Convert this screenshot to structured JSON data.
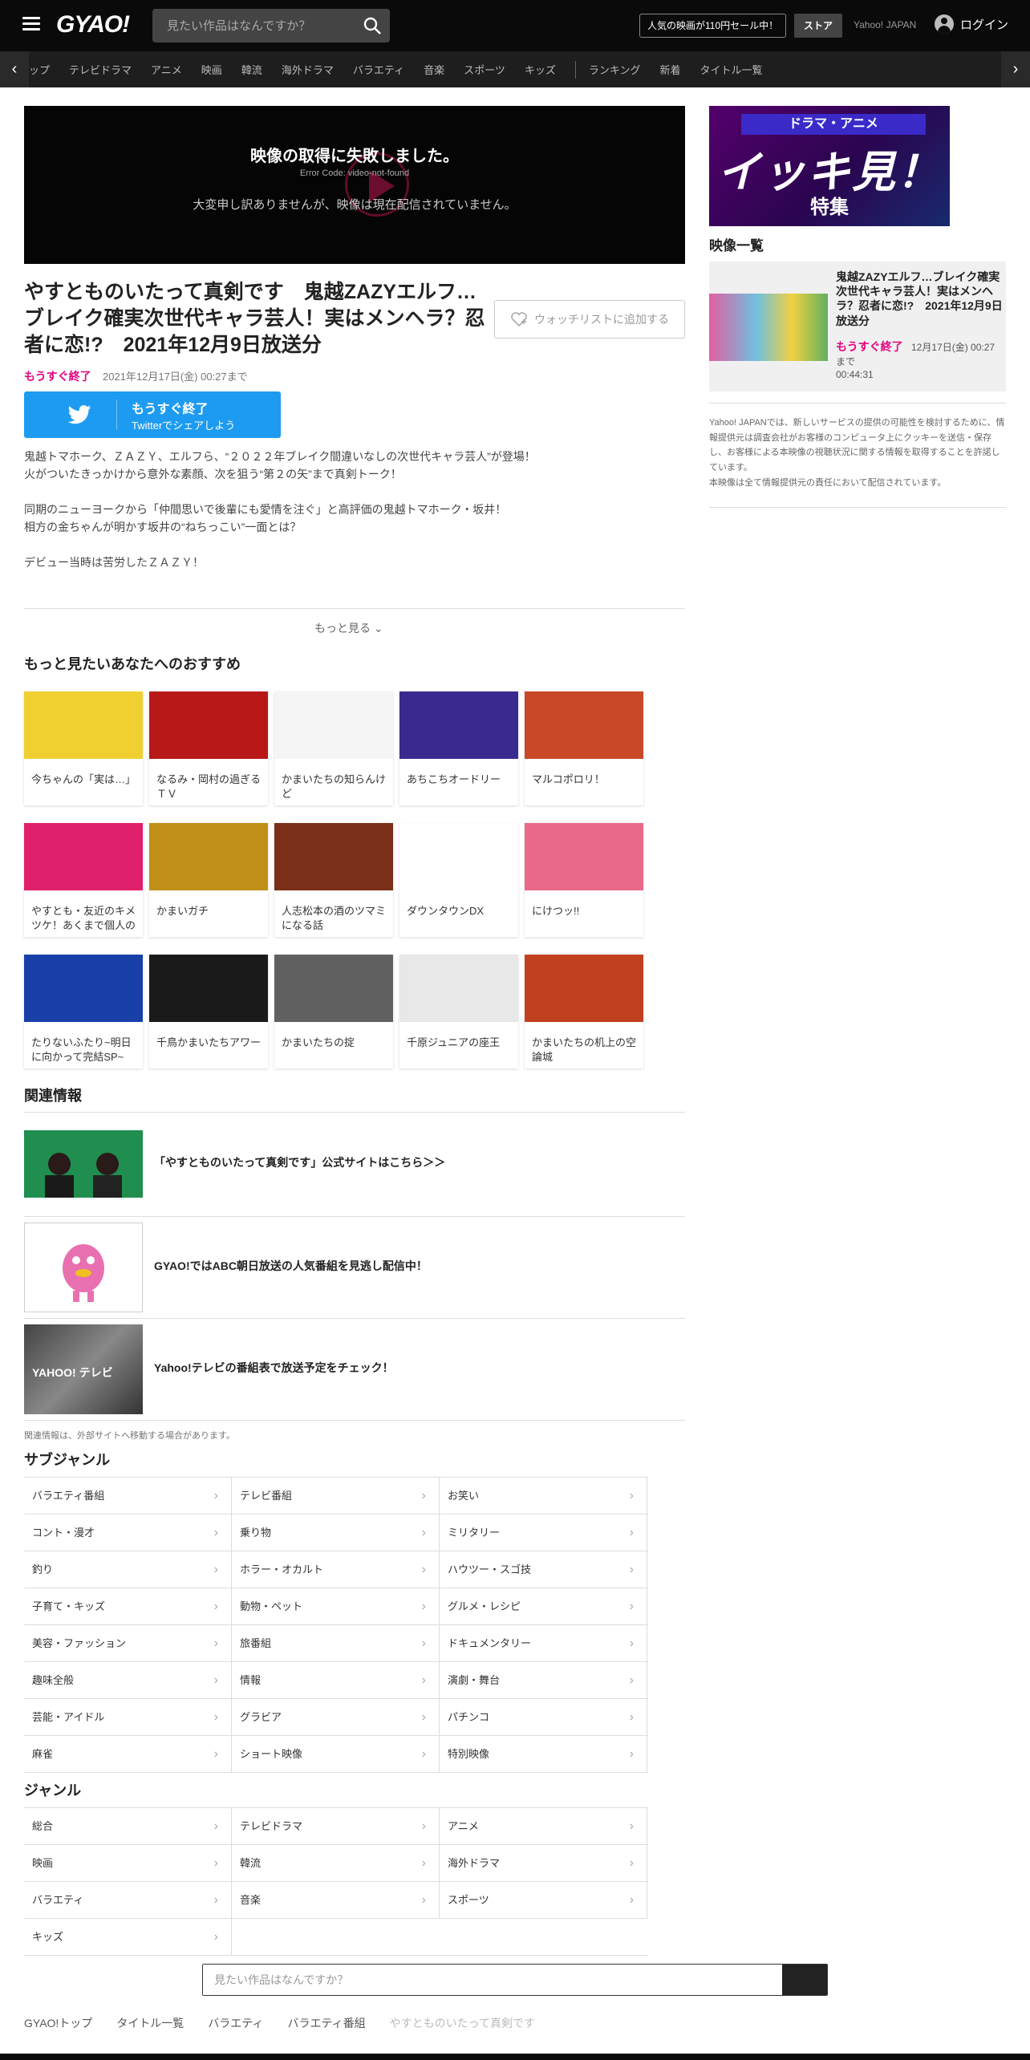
{
  "header": {
    "logo": "GYAO!",
    "search_placeholder": "見たい作品はなんですか？",
    "sale_badge": "人気の映画が110円セール中！",
    "store": "ストア",
    "yahoo_japan": "Yahoo! JAPAN",
    "login": "ログイン"
  },
  "nav": {
    "items": [
      "ップ",
      "テレビドラマ",
      "アニメ",
      "映画",
      "韓流",
      "海外ドラマ",
      "バラエティ",
      "音楽",
      "スポーツ",
      "キッズ"
    ],
    "items2": [
      "ランキング",
      "新着",
      "タイトル一覧"
    ]
  },
  "player": {
    "error_title": "映像の取得に失敗しました。",
    "error_code": "Error Code: video-not-found",
    "error_message": "大変申し訳ありませんが、映像は現在配信されていません。"
  },
  "episode": {
    "title": "やすとものいたって真剣です　鬼越ZAZYエルフ…ブレイク確実次世代キャラ芸人！実はメンヘラ？忍者に恋!?　2021年12月9日放送分",
    "watchlist": "ウォッチリストに追加する",
    "ending_label": "もうすぐ終了",
    "end_date": "2021年12月17日(金) 00:27まで",
    "twitter_main": "もうすぐ終了",
    "twitter_sub": "Twitterでシェアしよう",
    "description": [
      "鬼越トマホーク、ＺＡＺＹ、エルフら、“２０２２年ブレイク間違いなしの次世代キャラ芸人”が登場！\n火がついたきっかけから意外な素顔、次を狙う“第２の矢”まで真剣トーク！",
      "同期のニューヨークから「仲間思いで後輩にも愛情を注ぐ」と高評価の鬼越トマホーク・坂井！\n相方の金ちゃんが明かす坂井の“ねちっこい”一面とは？",
      "デビュー当時は苦労したＺＡＺＹ！"
    ],
    "more": "もっと見る"
  },
  "recommend": {
    "title": "もっと見たいあなたへのおすすめ",
    "items": [
      {
        "label": "今ちゃんの「実は…」",
        "color": "#f0d030"
      },
      {
        "label": "なるみ・岡村の過ぎるＴＶ",
        "color": "#b81818"
      },
      {
        "label": "かまいたちの知らんけど",
        "color": "#f5f5f5"
      },
      {
        "label": "あちこちオードリー",
        "color": "#3a2a90"
      },
      {
        "label": "マルコポロリ！",
        "color": "#c84828"
      },
      {
        "label": "やすとも・友近のキメツケ！あくまで個人の",
        "color": "#e0206a"
      },
      {
        "label": "かまいガチ",
        "color": "#c09018"
      },
      {
        "label": "人志松本の酒のツマミになる話",
        "color": "#7a3018"
      },
      {
        "label": "ダウンタウンDX",
        "color": "#ffffff"
      },
      {
        "label": "にけつッ!!",
        "color": "#e86a88"
      },
      {
        "label": "たりないふたり~明日に向かって完結SP~",
        "color": "#1840a8"
      },
      {
        "label": "千鳥かまいたちアワー",
        "color": "#1a1a1a"
      },
      {
        "label": "かまいたちの掟",
        "color": "#606060"
      },
      {
        "label": "千原ジュニアの座王",
        "color": "#e8e8e8"
      },
      {
        "label": "かまいたちの机上の空論城",
        "color": "#c04020"
      }
    ]
  },
  "related": {
    "title": "関連情報",
    "items": [
      {
        "text": "「やすとものいたって真剣です」公式サイトはこちら＞＞"
      },
      {
        "text": "GYAO!ではABC朝日放送の人気番組を見逃し配信中！"
      },
      {
        "text": "Yahoo!テレビの番組表で放送予定をチェック！"
      }
    ],
    "note": "関連情報は、外部サイトへ移動する場合があります。"
  },
  "subgenre": {
    "title": "サブジャンル",
    "items": [
      "バラエティ番組",
      "テレビ番組",
      "お笑い",
      "コント・漫才",
      "乗り物",
      "ミリタリー",
      "釣り",
      "ホラー・オカルト",
      "ハウツー・スゴ技",
      "子育て・キッズ",
      "動物・ペット",
      "グルメ・レシピ",
      "美容・ファッション",
      "旅番組",
      "ドキュメンタリー",
      "趣味全般",
      "情報",
      "演劇・舞台",
      "芸能・アイドル",
      "グラビア",
      "パチンコ",
      "麻雀",
      "ショート映像",
      "特別映像"
    ]
  },
  "genre": {
    "title": "ジャンル",
    "items": [
      "総合",
      "テレビドラマ",
      "アニメ",
      "映画",
      "韓流",
      "海外ドラマ",
      "バラエティ",
      "音楽",
      "スポーツ",
      "キッズ"
    ]
  },
  "bottom_search": {
    "placeholder": "見たい作品はなんですか？"
  },
  "breadcrumb": [
    "GYAO!トップ",
    "タイトル一覧",
    "バラエティ",
    "バラエティ番組",
    "やすとものいたって真剣です"
  ],
  "sidebar": {
    "banner_top": "ドラマ・アニメ",
    "banner_big": "イッキ見！",
    "banner_sub": "特集",
    "list_title": "映像一覧",
    "video": {
      "title": "鬼越ZAZYエルフ…ブレイク確実次世代キャラ芸人！実はメンヘラ？忍者に恋!?　2021年12月9日放送分",
      "ending": "もうすぐ終了",
      "date": "12月17日(金) 00:27",
      "made": "まで",
      "duration": "00:44:31"
    },
    "notice": "Yahoo! JAPANでは、新しいサービスの提供の可能性を検討するために、情報提供元は調査会社がお客様のコンピュータ上にクッキーを送信・保存し、お客様による本映像の視聴状況に関する情報を取得することを許諾しています。\n本映像は全て情報提供元の責任において配信されています。"
  },
  "colors": {
    "accent": "#e4007f",
    "twitter": "#1d9bf0",
    "header": "#0a0a0a"
  }
}
